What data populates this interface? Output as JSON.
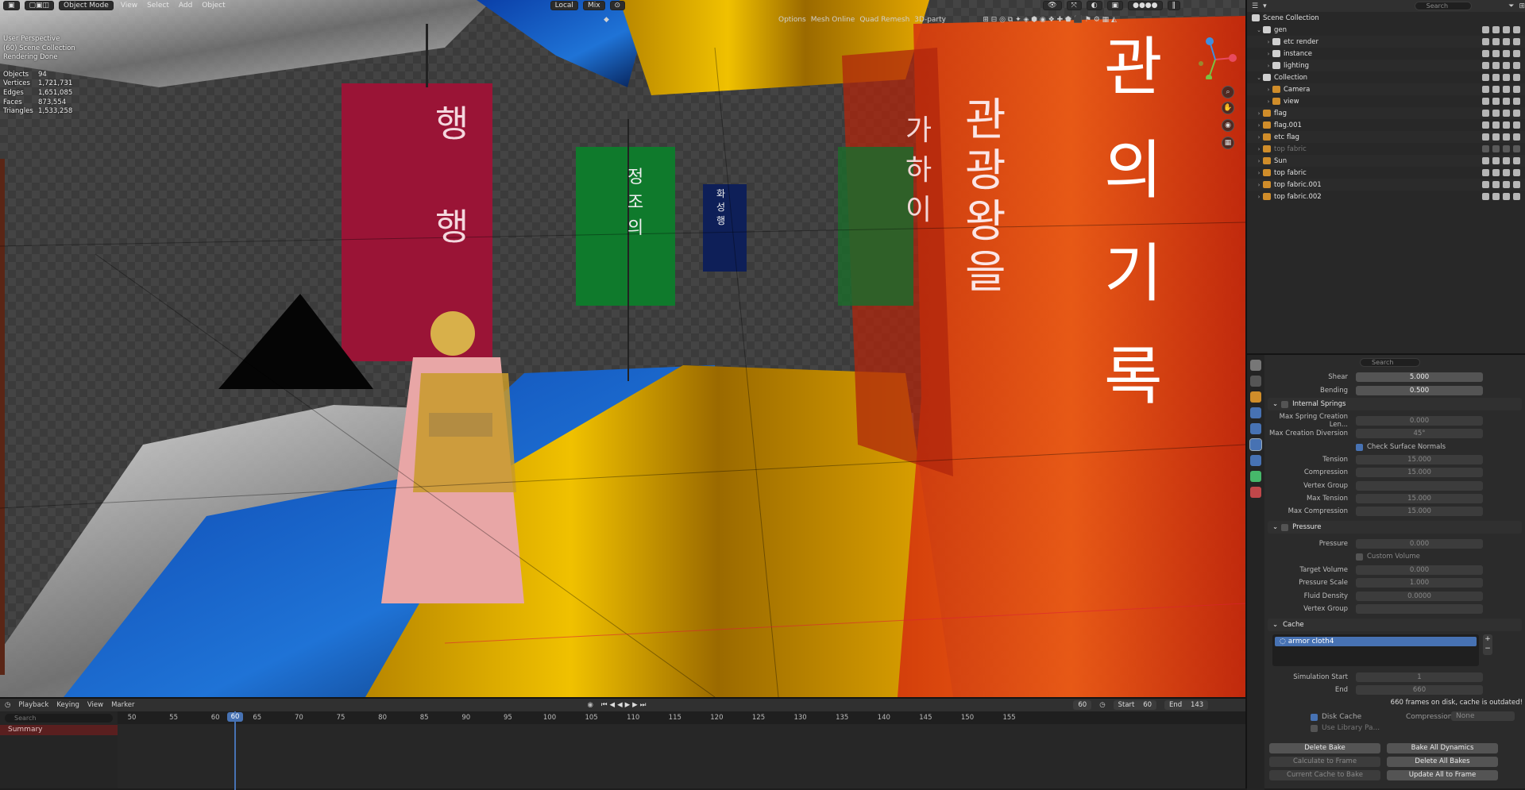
{
  "viewport": {
    "mode": "Object Mode",
    "menus": [
      "View",
      "Select",
      "Add",
      "Object"
    ],
    "orientation": "Local",
    "shading": "Mix",
    "overlay_buttons": [
      "Options",
      "Mesh Online",
      "Quad Remesh",
      "3D-party"
    ],
    "info": [
      "User Perspective",
      "(60) Scene Collection",
      "Rendering Done"
    ],
    "stats": [
      {
        "label": "Objects",
        "value": "94"
      },
      {
        "label": "Vertices",
        "value": "1,721,731"
      },
      {
        "label": "Edges",
        "value": "1,651,085"
      },
      {
        "label": "Faces",
        "value": "873,554"
      },
      {
        "label": "Triangles",
        "value": "1,533,258"
      }
    ],
    "banner_texts": [
      "행",
      "행",
      "정조의",
      "화성행",
      "관광왕을",
      "가하이",
      "관의 기록"
    ]
  },
  "outliner": {
    "search_placeholder": "Search",
    "root": "Scene Collection",
    "items": [
      {
        "label": "gen",
        "depth": 0,
        "color": "#cfcfcf",
        "expanded": true
      },
      {
        "label": "etc render",
        "depth": 1,
        "color": "#cfcfcf"
      },
      {
        "label": "instance",
        "depth": 1,
        "color": "#cfcfcf"
      },
      {
        "label": "lighting",
        "depth": 1,
        "color": "#cfcfcf"
      },
      {
        "label": "Collection",
        "depth": 0,
        "color": "#cfcfcf",
        "expanded": true
      },
      {
        "label": "Camera",
        "depth": 1,
        "color": "#d08d2a"
      },
      {
        "label": "view",
        "depth": 1,
        "color": "#d08d2a"
      },
      {
        "label": "flag",
        "depth": 0,
        "color": "#d08d2a"
      },
      {
        "label": "flag.001",
        "depth": 0,
        "color": "#d08d2a"
      },
      {
        "label": "etc flag",
        "depth": 0,
        "color": "#d08d2a"
      },
      {
        "label": "top fabric",
        "depth": 0,
        "color": "#d08d2a",
        "dim": true
      },
      {
        "label": "Sun",
        "depth": 0,
        "color": "#d08d2a"
      },
      {
        "label": "top fabric",
        "depth": 0,
        "color": "#d08d2a"
      },
      {
        "label": "top fabric.001",
        "depth": 0,
        "color": "#d08d2a"
      },
      {
        "label": "top fabric.002",
        "depth": 0,
        "color": "#d08d2a"
      }
    ]
  },
  "properties": {
    "search_placeholder": "Search",
    "shear": {
      "label": "Shear",
      "value": "5.000"
    },
    "bending": {
      "label": "Bending",
      "value": "0.500"
    },
    "internal_springs": {
      "title": "Internal Springs",
      "rows": [
        {
          "label": "Max Spring Creation Len...",
          "value": "0.000"
        },
        {
          "label": "Max Creation Diversion",
          "value": "45°"
        }
      ],
      "check_surface_normals": "Check Surface Normals",
      "rows2": [
        {
          "label": "Tension",
          "value": "15.000"
        },
        {
          "label": "Compression",
          "value": "15.000"
        },
        {
          "label": "Vertex Group",
          "value": ""
        },
        {
          "label": "Max Tension",
          "value": "15.000"
        },
        {
          "label": "Max Compression",
          "value": "15.000"
        }
      ]
    },
    "pressure": {
      "title": "Pressure",
      "pressure": {
        "label": "Pressure",
        "value": "0.000"
      },
      "custom_volume": "Custom Volume",
      "rows": [
        {
          "label": "Target Volume",
          "value": "0.000"
        },
        {
          "label": "Pressure Scale",
          "value": "1.000"
        },
        {
          "label": "Fluid Density",
          "value": "0.0000"
        },
        {
          "label": "Vertex Group",
          "value": ""
        }
      ]
    },
    "cache": {
      "title": "Cache",
      "item": "armor cloth4",
      "sim_start": {
        "label": "Simulation Start",
        "value": "1"
      },
      "end": {
        "label": "End",
        "value": "660"
      },
      "status": "660 frames on disk, cache is outdated!",
      "disk_cache": "Disk Cache",
      "use_library": "Use Library Pa...",
      "compression_label": "Compression",
      "compression_value": "None",
      "buttons": [
        "Delete Bake",
        "Bake All Dynamics",
        "Calculate to Frame",
        "Delete All Bakes",
        "Current Cache to Bake",
        "Update All to Frame"
      ]
    }
  },
  "timeline": {
    "menus": [
      "Playback",
      "Keying",
      "View",
      "Marker"
    ],
    "current_frame": "60",
    "start_label": "Start",
    "start": "60",
    "end_label": "End",
    "end": "143",
    "search_placeholder": "Search",
    "summary": "Summary",
    "ruler": [
      "50",
      "55",
      "60",
      "65",
      "70",
      "75",
      "80",
      "85",
      "90",
      "95",
      "100",
      "105",
      "110",
      "115",
      "120",
      "125",
      "130",
      "135",
      "140",
      "145",
      "150",
      "155"
    ]
  },
  "colors": {
    "accent": "#4772b3",
    "playhead": "#4772b3",
    "object_orange": "#d08d2a"
  }
}
